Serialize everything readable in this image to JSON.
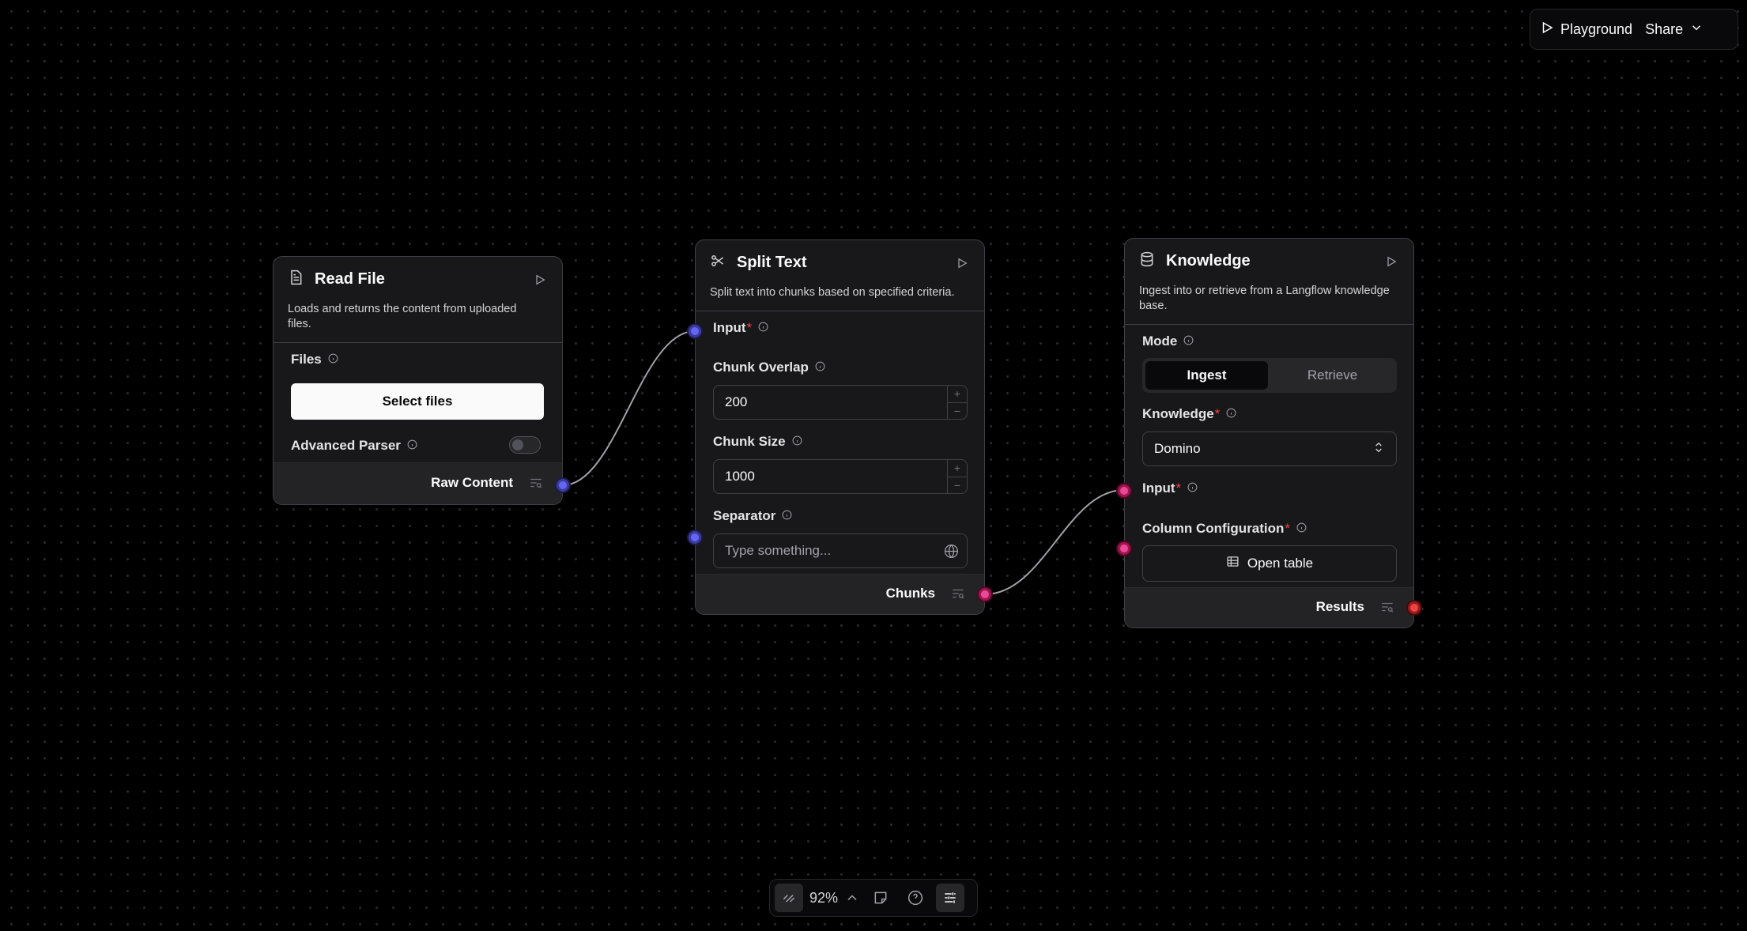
{
  "topbar": {
    "playground_label": "Playground",
    "share_label": "Share"
  },
  "nodes": {
    "read_file": {
      "title": "Read File",
      "description": "Loads and returns the content from uploaded files.",
      "files_label": "Files",
      "select_files_label": "Select files",
      "advanced_parser_label": "Advanced Parser",
      "advanced_parser_enabled": false,
      "output_label": "Raw Content"
    },
    "split_text": {
      "title": "Split Text",
      "description": "Split text into chunks based on specified criteria.",
      "input_label": "Input",
      "chunk_overlap_label": "Chunk Overlap",
      "chunk_overlap_value": "200",
      "chunk_size_label": "Chunk Size",
      "chunk_size_value": "1000",
      "separator_label": "Separator",
      "separator_placeholder": "Type something...",
      "output_label": "Chunks"
    },
    "knowledge": {
      "title": "Knowledge",
      "description": "Ingest into or retrieve from a Langflow knowledge base.",
      "mode_label": "Mode",
      "mode_options": [
        "Ingest",
        "Retrieve"
      ],
      "mode_selected": "Ingest",
      "knowledge_label": "Knowledge",
      "knowledge_value": "Domino",
      "input_label": "Input",
      "column_config_label": "Column Configuration",
      "open_table_label": "Open table",
      "output_label": "Results"
    }
  },
  "required_marker": "*",
  "bottombar": {
    "zoom": "92%"
  },
  "colors": {
    "handle_message": "#6366f1",
    "handle_data": "#ec4899",
    "handle_results": "#ef4444",
    "edge": "#a1a1aa"
  }
}
